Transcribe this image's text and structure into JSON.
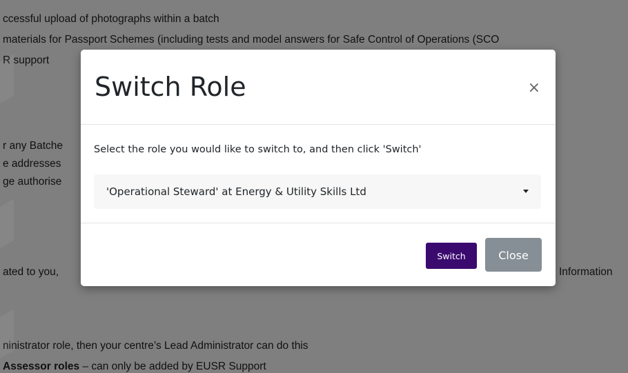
{
  "background": {
    "lines": [
      "ccessful upload of photographs within a batch",
      " materials for Passport Schemes (including tests and model answers for Safe Control of Operations (SCO",
      "R support",
      "r any Batche",
      "e addresses",
      "ge authorise",
      "ated to you,",
      "Information",
      "ninistrator role, then your centre’s Lead Administrator can do this",
      "Assessor roles",
      " – can only be added by EUSR Support"
    ]
  },
  "modal": {
    "title": "Switch Role",
    "close_icon": "×",
    "instructions": "Select the role you would like to switch to, and then click 'Switch'",
    "role_select": {
      "selected": "'Operational Steward' at Energy & Utility Skills Ltd"
    },
    "switch_label": "Switch",
    "close_label": "Close"
  },
  "colors": {
    "backdrop": "rgba(0,0,0,0.5)",
    "switch_button": "#3b0a6f",
    "close_button": "#868e96"
  }
}
